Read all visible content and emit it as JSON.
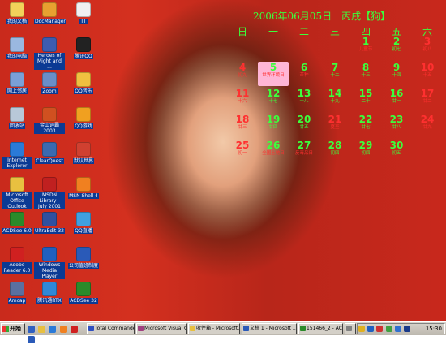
{
  "desktop": {
    "icons": [
      {
        "label": "我的文档",
        "icon": "folder-icon",
        "color": "#f2d25a"
      },
      {
        "label": "DocManager",
        "icon": "person-icon",
        "color": "#e8a030"
      },
      {
        "label": "TT",
        "icon": "browser-icon",
        "color": "#f0f0f0"
      },
      {
        "label": "我的电脑",
        "icon": "computer-icon",
        "color": "#9ab8e0"
      },
      {
        "label": "Heroes of Might and ...",
        "icon": "game-icon",
        "color": "#3c5cb0"
      },
      {
        "label": "腾讯QQ",
        "icon": "qq-icon",
        "color": "#222222"
      },
      {
        "label": "网上邻居",
        "icon": "network-icon",
        "color": "#7aa0d8"
      },
      {
        "label": "Zoom",
        "icon": "magnifier-icon",
        "color": "#6a8ec8"
      },
      {
        "label": "QQ音乐",
        "icon": "qq-music-icon",
        "color": "#f0c040"
      },
      {
        "label": "回收站",
        "icon": "recycle-bin-icon",
        "color": "#b8c8d8"
      },
      {
        "label": "金山词霸2003",
        "icon": "dictionary-icon",
        "color": "#d05020"
      },
      {
        "label": "QQ游戏",
        "icon": "qq-game-icon",
        "color": "#f0a020"
      },
      {
        "label": "Internet Explorer",
        "icon": "ie-icon",
        "color": "#2a7ad8"
      },
      {
        "label": "ClearQuest",
        "icon": "clearquest-icon",
        "color": "#3a6ab0"
      },
      {
        "label": "默认世界",
        "icon": "world-icon",
        "color": "#d04030"
      },
      {
        "label": "Microsoft Office Outlook",
        "icon": "outlook-icon",
        "color": "#e8c040"
      },
      {
        "label": "MSDN Library - July 2001",
        "icon": "msdn-icon",
        "color": "#c02020"
      },
      {
        "label": "MSN Shell 4",
        "icon": "msn-icon",
        "color": "#f08020"
      },
      {
        "label": "ACDSee 6.0",
        "icon": "acdsee-icon",
        "color": "#2a8a2a"
      },
      {
        "label": "UltraEdit-32",
        "icon": "ultraedit-icon",
        "color": "#3050a0"
      },
      {
        "label": "QQ直播",
        "icon": "qq-live-icon",
        "color": "#40a0e0"
      },
      {
        "label": "Adobe Reader 6.0",
        "icon": "adobe-reader-icon",
        "color": "#d02020"
      },
      {
        "label": "Windows Media Player",
        "icon": "media-player-icon",
        "color": "#2060c0"
      },
      {
        "label": "公司值班制度",
        "icon": "word-document-icon",
        "color": "#2a5ab8"
      },
      {
        "label": "Amcap",
        "icon": "camera-icon",
        "color": "#5a70a0"
      },
      {
        "label": "腾讯通RTX",
        "icon": "rtx-icon",
        "color": "#3088d8"
      },
      {
        "label": "ACDSee 32",
        "icon": "acdsee32-icon",
        "color": "#2a8a2a"
      }
    ]
  },
  "calendar": {
    "title": "2006年06月05日　丙戌【狗】",
    "weekdays": [
      "日",
      "一",
      "二",
      "三",
      "四",
      "五",
      "六"
    ],
    "days": [
      {
        "day": "1",
        "lunar": "儿童节",
        "color": "#3cff3c",
        "lcolor": "#ff3030"
      },
      {
        "day": "2",
        "lunar": "初七",
        "color": "#3cff3c",
        "lcolor": "#3cff3c"
      },
      {
        "day": "3",
        "lunar": "初八",
        "color": "#ff3030",
        "lcolor": "#ff3030"
      },
      {
        "day": "4",
        "lunar": "初九",
        "color": "#ff3030",
        "lcolor": "#ff3030"
      },
      {
        "day": "5",
        "lunar": "世界环境日",
        "color": "#3cff3c",
        "lcolor": "#ff3030",
        "today": true
      },
      {
        "day": "6",
        "lunar": "芒种",
        "color": "#3cff3c",
        "lcolor": "#ff3030"
      },
      {
        "day": "7",
        "lunar": "十二",
        "color": "#3cff3c",
        "lcolor": "#3cff3c"
      },
      {
        "day": "8",
        "lunar": "十三",
        "color": "#3cff3c",
        "lcolor": "#3cff3c"
      },
      {
        "day": "9",
        "lunar": "十四",
        "color": "#3cff3c",
        "lcolor": "#3cff3c"
      },
      {
        "day": "10",
        "lunar": "十五",
        "color": "#ff3030",
        "lcolor": "#ff3030"
      },
      {
        "day": "11",
        "lunar": "十六",
        "color": "#ff3030",
        "lcolor": "#ff3030"
      },
      {
        "day": "12",
        "lunar": "十七",
        "color": "#3cff3c",
        "lcolor": "#3cff3c"
      },
      {
        "day": "13",
        "lunar": "十八",
        "color": "#3cff3c",
        "lcolor": "#3cff3c"
      },
      {
        "day": "14",
        "lunar": "十九",
        "color": "#3cff3c",
        "lcolor": "#3cff3c"
      },
      {
        "day": "15",
        "lunar": "二十",
        "color": "#3cff3c",
        "lcolor": "#3cff3c"
      },
      {
        "day": "16",
        "lunar": "廿一",
        "color": "#3cff3c",
        "lcolor": "#3cff3c"
      },
      {
        "day": "17",
        "lunar": "廿二",
        "color": "#ff3030",
        "lcolor": "#ff3030"
      },
      {
        "day": "18",
        "lunar": "廿三",
        "color": "#ff3030",
        "lcolor": "#ff3030"
      },
      {
        "day": "19",
        "lunar": "廿四",
        "color": "#3cff3c",
        "lcolor": "#3cff3c"
      },
      {
        "day": "20",
        "lunar": "廿五",
        "color": "#3cff3c",
        "lcolor": "#3cff3c"
      },
      {
        "day": "21",
        "lunar": "夏至",
        "color": "#ff3030",
        "lcolor": "#ff3030"
      },
      {
        "day": "22",
        "lunar": "廿七",
        "color": "#3cff3c",
        "lcolor": "#3cff3c"
      },
      {
        "day": "23",
        "lunar": "廿八",
        "color": "#3cff3c",
        "lcolor": "#3cff3c"
      },
      {
        "day": "24",
        "lunar": "廿九",
        "color": "#ff3030",
        "lcolor": "#ff3030"
      },
      {
        "day": "25",
        "lunar": "初一",
        "color": "#ff3030",
        "lcolor": "#ff3030"
      },
      {
        "day": "26",
        "lunar": "全国土地日",
        "color": "#3cff3c",
        "lcolor": "#ff3030"
      },
      {
        "day": "27",
        "lunar": "反毒品日",
        "color": "#3cff3c",
        "lcolor": "#ff3030"
      },
      {
        "day": "28",
        "lunar": "初四",
        "color": "#3cff3c",
        "lcolor": "#3cff3c"
      },
      {
        "day": "29",
        "lunar": "初四",
        "color": "#3cff3c",
        "lcolor": "#3cff3c"
      },
      {
        "day": "30",
        "lunar": "初五",
        "color": "#3cff3c",
        "lcolor": "#3cff3c"
      }
    ]
  },
  "taskbar": {
    "start_label": "开始",
    "tasks": [
      {
        "label": "Total Commander...",
        "icon": "total-commander-icon",
        "color": "#3050c0"
      },
      {
        "label": "Microsoft Visual C...",
        "icon": "visual-c-icon",
        "color": "#a04080"
      },
      {
        "label": "收件箱 - Microsoft...",
        "icon": "outlook-inbox-icon",
        "color": "#e8c040"
      },
      {
        "label": "文档 1 - Microsoft ...",
        "icon": "word-icon",
        "color": "#2a5ab8"
      },
      {
        "label": "151466_2 - ACDS...",
        "icon": "acdsee-task-icon",
        "color": "#2a8a2a"
      },
      {
        "label": "",
        "icon": "extra-task-icon",
        "color": "#808080"
      }
    ],
    "clock": "15:30"
  }
}
